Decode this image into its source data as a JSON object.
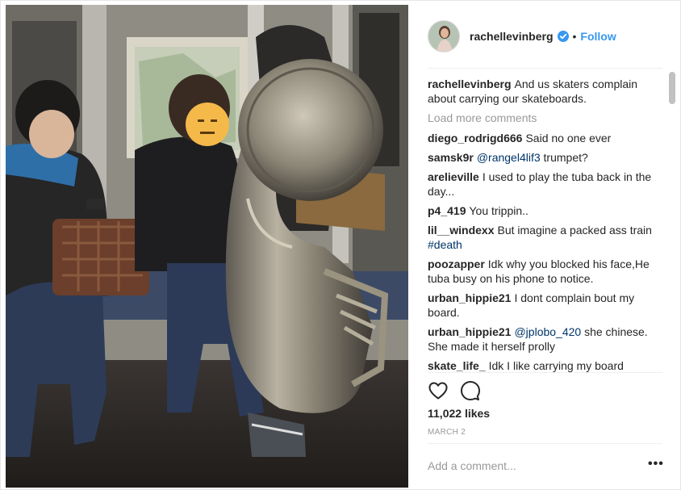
{
  "post": {
    "username": "rachellevinberg",
    "dot": "•",
    "follow_label": "Follow",
    "caption": {
      "user": "rachellevinberg",
      "text": "And us skaters complain about carrying our skateboards."
    },
    "load_more": "Load more comments",
    "comments": [
      {
        "user": "diego_rodrigd666",
        "mention": "",
        "text": "Said no one ever"
      },
      {
        "user": "samsk9r",
        "mention": "@rangel4lif3",
        "text": " trumpet?"
      },
      {
        "user": "arelieville",
        "mention": "",
        "text": "I used to play the tuba back in the day..."
      },
      {
        "user": "p4_419",
        "mention": "",
        "text": "You trippin.."
      },
      {
        "user": "lil__windexx",
        "mention": "",
        "text": "But imagine a packed ass train ",
        "tag": "#death"
      },
      {
        "user": "poozapper",
        "mention": "",
        "text": "Idk why you blocked his face,He tuba busy on his phone to notice."
      },
      {
        "user": "urban_hippie21",
        "mention": "",
        "text": "I dont complain bout my board."
      },
      {
        "user": "urban_hippie21",
        "mention": "@jplobo_420",
        "text": " she chinese. She made it herself prolly"
      },
      {
        "user": "skate_life_",
        "mention": "",
        "text": "Idk I like carrying my board"
      }
    ],
    "likes": "11,022 likes",
    "date": "MARCH 2",
    "add_comment_placeholder": "Add a comment...",
    "more_label": "•••",
    "icons": {
      "verified": "verified-badge-icon",
      "like": "heart-icon",
      "comment": "comment-bubble-icon",
      "more": "more-options-icon"
    },
    "colors": {
      "link": "#3897f0",
      "muted": "#999999",
      "mention": "#003569",
      "text": "#262626"
    }
  }
}
